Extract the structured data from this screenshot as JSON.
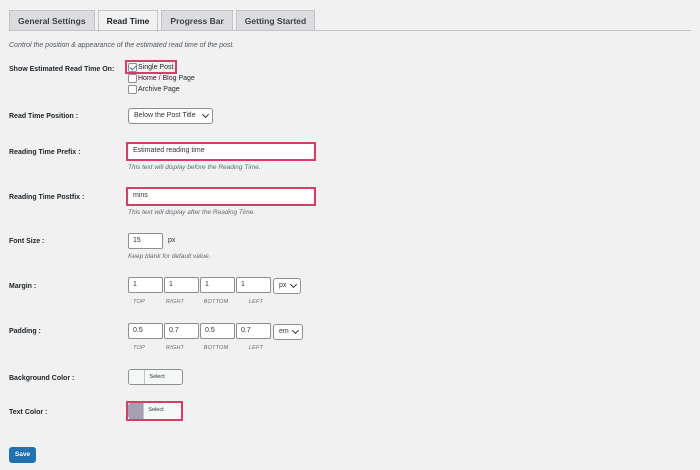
{
  "tabs": [
    {
      "label": "General Settings",
      "active": false
    },
    {
      "label": "Read Time",
      "active": true
    },
    {
      "label": "Progress Bar",
      "active": false
    },
    {
      "label": "Getting Started",
      "active": false
    }
  ],
  "intro": "Control the position & appearance of the estimated read time of the post.",
  "show_on": {
    "label": "Show Estimated Read Time On:",
    "options": [
      {
        "label": "Single Post",
        "checked": true
      },
      {
        "label": "Home / Blog Page",
        "checked": false
      },
      {
        "label": "Archive Page",
        "checked": false
      }
    ]
  },
  "position": {
    "label": "Read Time Position :",
    "value": "Below the Post Title"
  },
  "prefix": {
    "label": "Reading Time Prefix :",
    "value": "Estimated reading time",
    "desc": "This text will display before the Reading Time."
  },
  "postfix": {
    "label": "Reading Time Postfix :",
    "value": "mins",
    "desc": "This text will display after the Reading Time."
  },
  "font_size": {
    "label": "Font Size :",
    "value": "15",
    "unit": "px",
    "desc": "Keep blank for default value."
  },
  "margin": {
    "label": "Margin :",
    "values": [
      "1",
      "1",
      "1",
      "1"
    ],
    "sides": [
      "TOP",
      "RIGHT",
      "BOTTOM",
      "LEFT"
    ],
    "unit": "px"
  },
  "padding": {
    "label": "Padding :",
    "values": [
      "0.5",
      "0.7",
      "0.5",
      "0.7"
    ],
    "sides": [
      "TOP",
      "RIGHT",
      "BOTTOM",
      "LEFT"
    ],
    "unit": "em"
  },
  "bg_color": {
    "label": "Background Color :",
    "button": "Select Color",
    "swatch": "#f6f7f7"
  },
  "text_color": {
    "label": "Text Color :",
    "button": "Select Color",
    "swatch": "#a5a0b3"
  },
  "save_label": "Save",
  "colors": {
    "accent": "#2271b1",
    "highlight": "#d63e68"
  }
}
